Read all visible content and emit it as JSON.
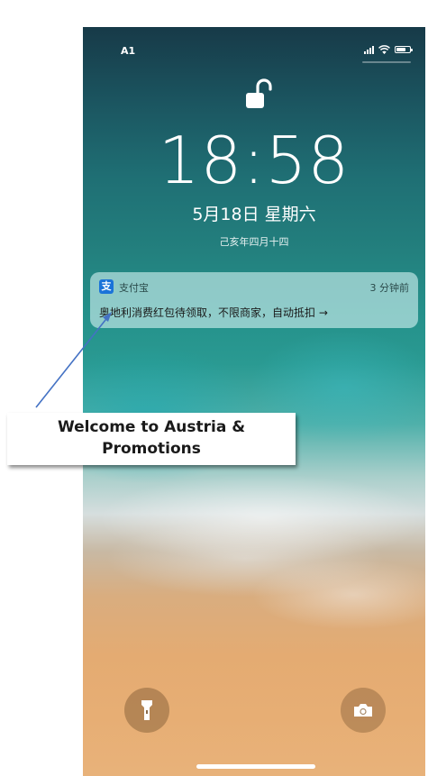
{
  "status_bar": {
    "carrier": "A1",
    "icons": [
      "signal-icon",
      "wifi-icon",
      "battery-icon"
    ]
  },
  "lock_screen": {
    "lock_state_icon": "unlocked-padlock-icon",
    "time": "18:58",
    "date": "5月18日 星期六",
    "lunar_date": "己亥年四月十四"
  },
  "notification": {
    "app_icon": "alipay-icon",
    "app_icon_glyph": "支",
    "app_name": "支付宝",
    "time_ago": "3 分钟前",
    "body": "奥地利消费红包待领取，不限商家，自动抵扣 →",
    "app_icon_color": "#1a73d9"
  },
  "bottom_controls": {
    "left": "flashlight-icon",
    "right": "camera-icon"
  },
  "annotation": {
    "line1": "Welcome to Austria &",
    "line2": "Promotions",
    "arrow_color": "#4472c4"
  }
}
